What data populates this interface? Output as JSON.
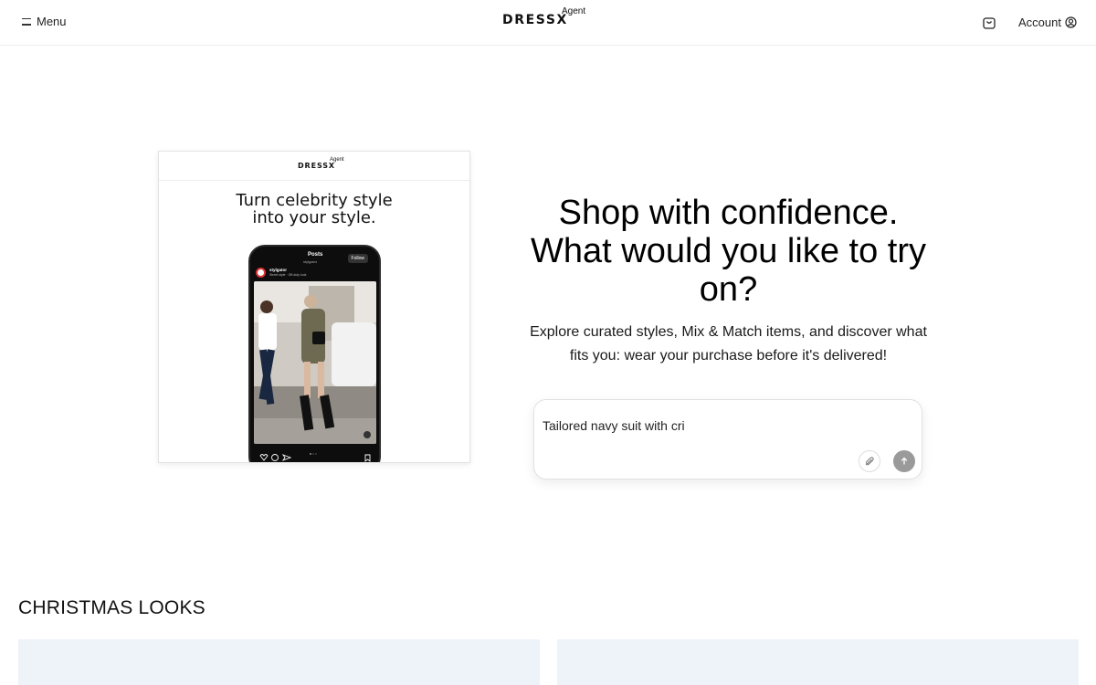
{
  "header": {
    "menu_label": "Menu",
    "logo_text": "DRESSX",
    "logo_sup": "Agent",
    "account_label": "Account"
  },
  "preview": {
    "logo_text": "DRESSX",
    "logo_sup": "Agent",
    "headline_line1": "Turn celebrity style",
    "headline_line2": "into your style.",
    "phone_title": "Posts",
    "phone_subtitle": "stylgator",
    "phone_follow": "Follow",
    "phone_username": "stylgator",
    "phone_caption": "Street style · Off-duty look"
  },
  "hero": {
    "title_line1": "Shop with confidence.",
    "title_line2": "What would you like to try",
    "title_line3": "on?",
    "subtitle_line1": "Explore curated styles, Mix & Match items, and discover what",
    "subtitle_line2": "fits you: wear your purchase before it's delivered!"
  },
  "prompt": {
    "value": "Tailored navy suit with cri"
  },
  "section": {
    "title": "CHRISTMAS LOOKS"
  },
  "colors": {
    "accent_gray": "#9a9a9a",
    "card_bg": "#eef3fa"
  }
}
